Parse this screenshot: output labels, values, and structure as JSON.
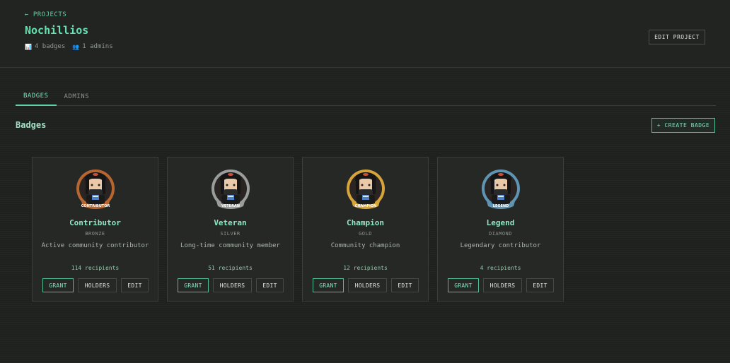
{
  "header": {
    "back_label": "← PROJECTS",
    "project_name": "Nochillios",
    "meta": [
      {
        "icon": "chart-icon",
        "glyph": "📊",
        "text": "4 badges"
      },
      {
        "icon": "people-icon",
        "glyph": "👥",
        "text": "1 admins"
      }
    ],
    "edit_project_label": "EDIT PROJECT"
  },
  "tabs": [
    {
      "label": "BADGES",
      "active": true
    },
    {
      "label": "ADMINS",
      "active": false
    }
  ],
  "section": {
    "title": "Badges",
    "create_label": "+ CREATE BADGE"
  },
  "badges": [
    {
      "name": "Contributor",
      "tier": "BRONZE",
      "description": "Active community contributor",
      "recipients": "114 recipients",
      "ring_color": "#b8662f",
      "ribbon_text": "CONTRIBUTOR"
    },
    {
      "name": "Veteran",
      "tier": "SILVER",
      "description": "Long-time community member",
      "recipients": "51 recipients",
      "ring_color": "#9a9d9c",
      "ribbon_text": "VETERAN"
    },
    {
      "name": "Champion",
      "tier": "GOLD",
      "description": "Community champion",
      "recipients": "12 recipients",
      "ring_color": "#d6a43a",
      "ribbon_text": "CHAMPION"
    },
    {
      "name": "Legend",
      "tier": "DIAMOND",
      "description": "Legendary contributor",
      "recipients": "4 recipients",
      "ring_color": "#5f94b2",
      "ribbon_text": "LEGEND"
    }
  ],
  "card_actions": {
    "grant": "GRANT",
    "holders": "HOLDERS",
    "edit": "EDIT"
  }
}
